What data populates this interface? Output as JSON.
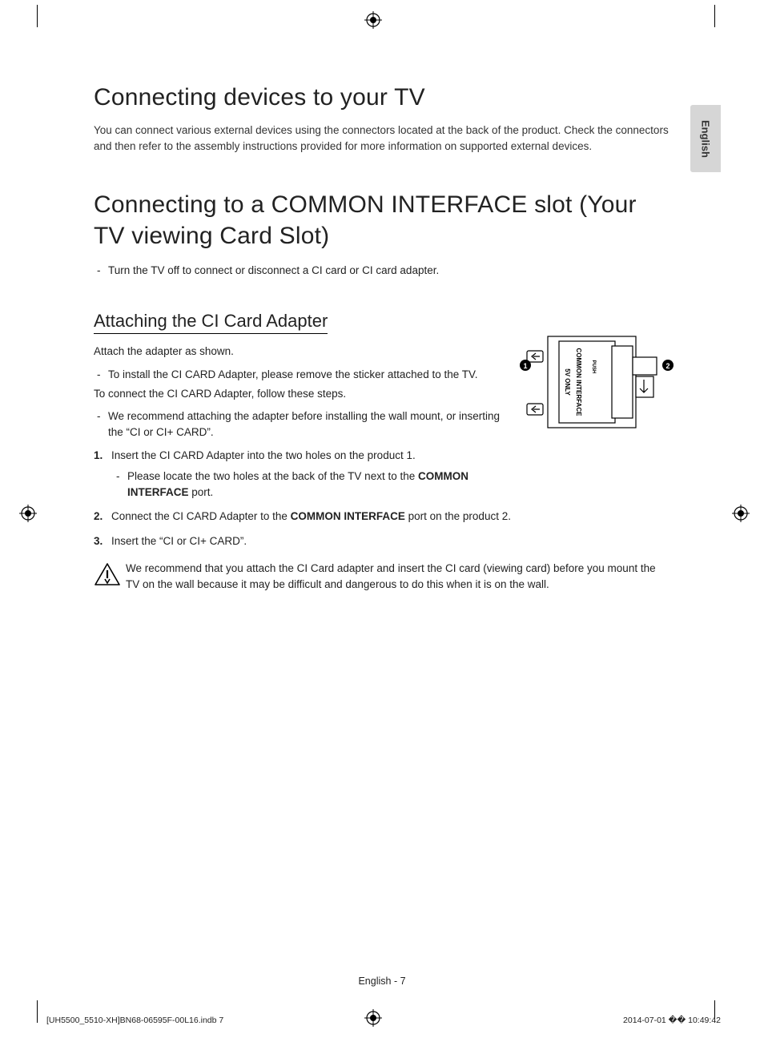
{
  "tab_label": "English",
  "h1a": "Connecting devices to your TV",
  "intro": "You can connect various external devices using the connectors located at the back of the product. Check the connectors and then refer to the assembly instructions provided for more information on supported external devices.",
  "h1b": "Connecting to a COMMON INTERFACE slot (Your TV viewing Card Slot)",
  "dash1": "Turn the TV off to connect or disconnect a CI card or CI card adapter.",
  "h2": "Attaching the CI Card Adapter",
  "p_attach": "Attach the adapter as shown.",
  "dash2": "To install the CI CARD Adapter, please remove the sticker attached to the TV.",
  "p_follow": "To connect the CI CARD Adapter, follow these steps.",
  "dash3": "We recommend attaching the adapter before installing the wall mount, or inserting the “CI or CI+ CARD”.",
  "step1": "Insert the CI CARD Adapter into the two holes on the product 1.",
  "step1_sub_a": "Please locate the two holes at the back of the TV next to the ",
  "step1_sub_b": "COMMON INTERFACE",
  "step1_sub_c": " port.",
  "step2_a": "Connect the CI CARD Adapter to the ",
  "step2_b": "COMMON INTERFACE",
  "step2_c": " port on the product 2.",
  "step3": "Insert the “CI or CI+ CARD”.",
  "warn": "We recommend that you attach the CI Card adapter and insert the CI card (viewing card) before you mount the TV on the wall because it may be difficult and dangerous to do this when it is on the wall.",
  "fig": {
    "label_ci": "COMMON INTERFACE",
    "label_5v": "5V ONLY",
    "label_push": "PUSH",
    "callout1": "1",
    "callout2": "2"
  },
  "footer_center": "English - 7",
  "footer_left": "[UH5500_5510-XH]BN68-06595F-00L16.indb   7",
  "footer_right": "2014-07-01   �� 10:49:42"
}
